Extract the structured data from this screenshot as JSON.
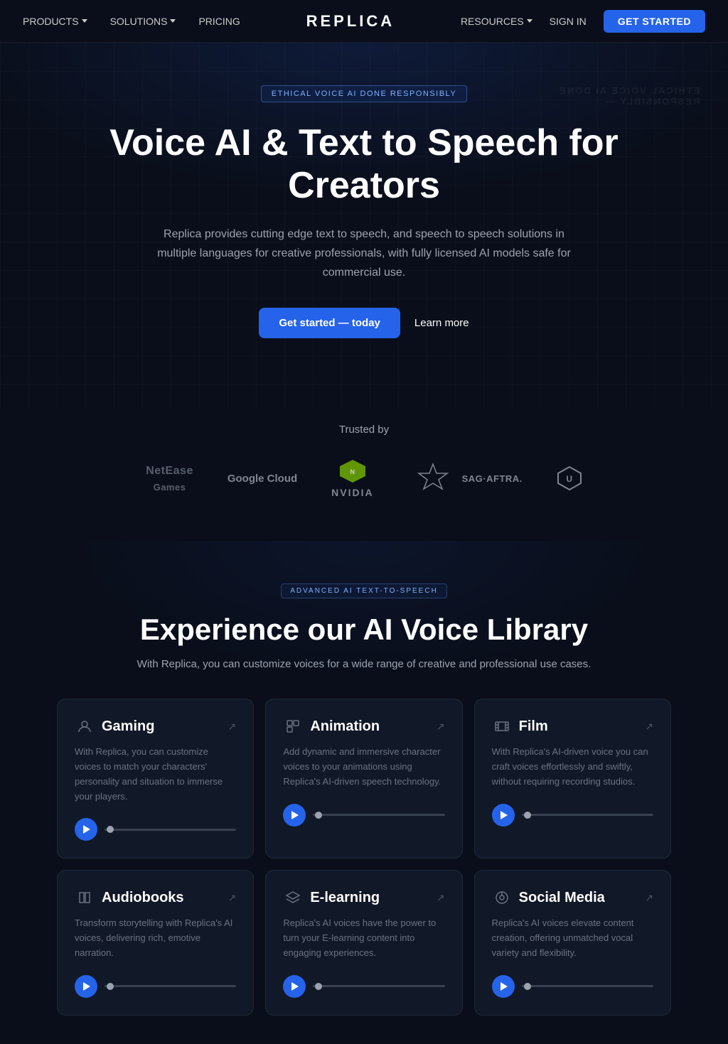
{
  "nav": {
    "logo": "REPLICA",
    "items": [
      {
        "label": "PRODUCTS",
        "hasDropdown": true
      },
      {
        "label": "SOLUTIONS",
        "hasDropdown": true
      },
      {
        "label": "PRICING",
        "hasDropdown": false
      }
    ],
    "right": [
      {
        "label": "RESOURCES",
        "hasDropdown": true
      },
      {
        "label": "SIGN IN",
        "hasDropdown": false
      }
    ],
    "cta": "GET STARTED"
  },
  "hero": {
    "badge": "ETHICAL VOICE AI DONE RESPONSIBLY",
    "title": "Voice AI & Text to Speech for Creators",
    "subtitle": "Replica provides cutting edge text to speech, and speech to speech solutions in multiple languages for creative professionals, with fully licensed AI models safe for commercial use.",
    "cta_primary": "Get started — today",
    "cta_secondary": "Learn more",
    "bg_text_line1": "ETHICAL VOICE AI DONE",
    "bg_text_line2": "RESPONSIBLY —"
  },
  "trusted": {
    "label": "Trusted by",
    "logos": [
      {
        "name": "NetEase Games",
        "type": "netease"
      },
      {
        "name": "Google Cloud",
        "type": "google"
      },
      {
        "name": "NVIDIA",
        "type": "nvidia"
      },
      {
        "name": "SAG·AFTRA",
        "type": "sag"
      },
      {
        "name": "Unity",
        "type": "unity"
      }
    ]
  },
  "voice_library": {
    "badge": "ADVANCED AI TEXT-TO-SPEECH",
    "title": "Experience our AI Voice Library",
    "subtitle": "With Replica, you can customize voices for a wide range of creative and professional use cases.",
    "cards": [
      {
        "id": "gaming",
        "icon": "👤",
        "title": "Gaming",
        "desc": "With Replica, you can customize voices to match your characters' personality and situation to immerse your players."
      },
      {
        "id": "animation",
        "icon": "🎭",
        "title": "Animation",
        "desc": "Add dynamic and immersive character voices to your animations using Replica's AI-driven speech technology."
      },
      {
        "id": "film",
        "icon": "🎬",
        "title": "Film",
        "desc": "With Replica's AI-driven voice you can craft voices effortlessly and swiftly, without requiring recording studios."
      },
      {
        "id": "audiobooks",
        "icon": "📖",
        "title": "Audiobooks",
        "desc": "Transform storytelling with Replica's AI voices, delivering rich, emotive narration."
      },
      {
        "id": "elearning",
        "icon": "🎓",
        "title": "E-learning",
        "desc": "Replica's AI voices have the power to turn your E-learning content into engaging experiences."
      },
      {
        "id": "socialmedia",
        "icon": "🎙️",
        "title": "Social Media",
        "desc": "Replica's AI voices elevate content creation, offering unmatched vocal variety and flexibility."
      }
    ]
  }
}
